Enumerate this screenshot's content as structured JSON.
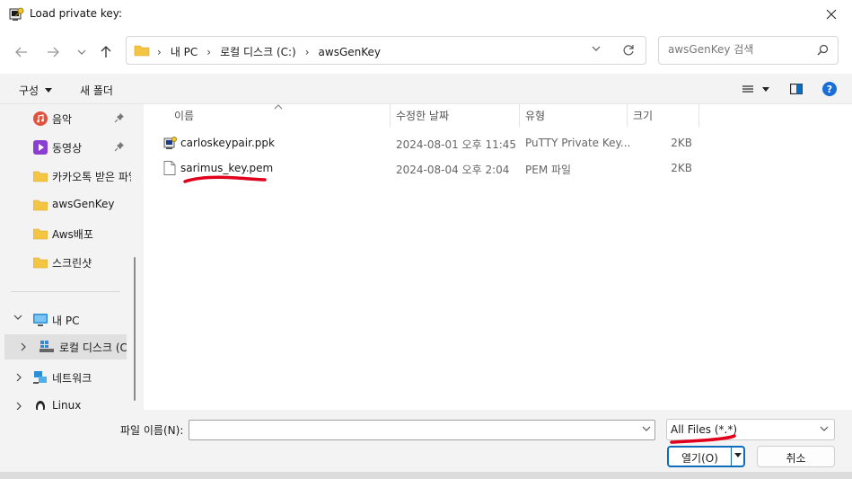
{
  "window": {
    "title": "Load private key:"
  },
  "address": {
    "crumbs": [
      "내 PC",
      "로컬 디스크 (C:)",
      "awsGenKey"
    ],
    "search_placeholder": "awsGenKey 검색"
  },
  "commands": {
    "organize": "구성",
    "new_folder": "새 폴더"
  },
  "nav": {
    "quick": [
      {
        "label": "음악",
        "icon": "music-icon",
        "pinned": true
      },
      {
        "label": "동영상",
        "icon": "video-icon",
        "pinned": true
      },
      {
        "label": "카카오톡 받은 파일",
        "icon": "folder-icon",
        "pinned": false
      },
      {
        "label": "awsGenKey",
        "icon": "folder-icon",
        "pinned": false
      },
      {
        "label": "Aws배포",
        "icon": "folder-icon",
        "pinned": false
      },
      {
        "label": "스크린샷",
        "icon": "folder-icon",
        "pinned": false
      }
    ],
    "pc": "내 PC",
    "local_disk": "로컬 디스크 (C:)",
    "network": "네트워크",
    "linux": "Linux"
  },
  "columns": {
    "name": "이름",
    "date": "수정한 날짜",
    "type": "유형",
    "size": "크기"
  },
  "files": [
    {
      "name": "carloskeypair.ppk",
      "date": "2024-08-01 오후 11:45",
      "type": "PuTTY Private Key...",
      "size": "2KB",
      "icon": "putty-key-icon"
    },
    {
      "name": "sarimus_key.pem",
      "date": "2024-08-04 오후 2:04",
      "type": "PEM 파일",
      "size": "2KB",
      "icon": "file-icon"
    }
  ],
  "bottom": {
    "filename_label": "파일 이름(N):",
    "filename_value": "",
    "filter": "All Files (*.*)",
    "open": "열기(O)",
    "cancel": "취소"
  },
  "colors": {
    "accent": "#0f6cbd",
    "annotation": "#e0001b",
    "folder": "#f4c542"
  }
}
